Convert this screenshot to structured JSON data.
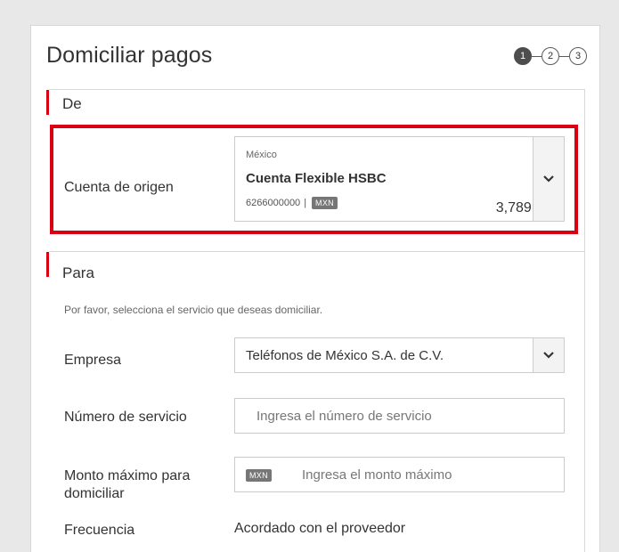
{
  "page": {
    "title": "Domiciliar pagos"
  },
  "stepper": {
    "steps": [
      "1",
      "2",
      "3"
    ],
    "active": 1
  },
  "sections": {
    "from": {
      "title": "De",
      "origin_account": {
        "label": "Cuenta de origen",
        "country": "México",
        "name": "Cuenta Flexible HSBC",
        "number": "6266000000",
        "separator": "|",
        "currency": "MXN",
        "balance": "3,789.10",
        "dropdown_icon": "chevron-down-icon"
      }
    },
    "to": {
      "title": "Para",
      "hint": "Por favor, selecciona el servicio que deseas domiciliar.",
      "company": {
        "label": "Empresa",
        "value": "Teléfonos de México S.A. de C.V.",
        "dropdown_icon": "chevron-down-icon"
      },
      "service_number": {
        "label": "Número de servicio",
        "placeholder": "Ingresa el número de servicio"
      },
      "max_amount": {
        "label": "Monto máximo para domiciliar",
        "currency": "MXN",
        "placeholder": "Ingresa el monto máximo"
      },
      "frequency": {
        "label": "Frecuencia",
        "value": "Acordado con el proveedor"
      }
    }
  },
  "colors": {
    "accent": "#db0011",
    "step_active": "#4d4d4d",
    "tag_bg": "#767676",
    "page_bg": "#e8e8e8"
  }
}
